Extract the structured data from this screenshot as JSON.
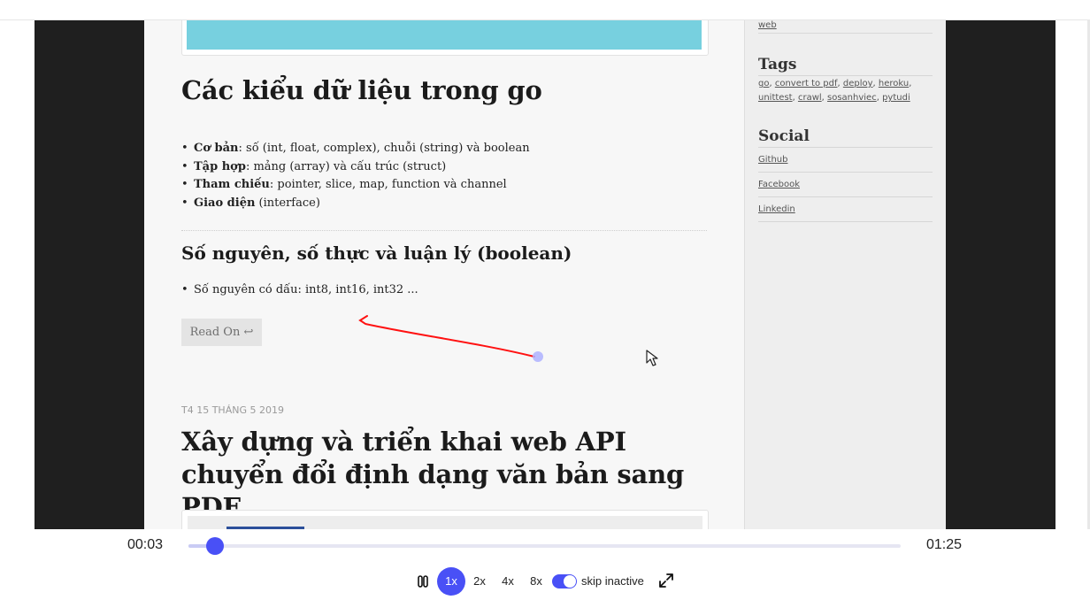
{
  "article": {
    "title": "Các kiểu dữ liệu trong go",
    "types": [
      {
        "term": "Cơ bản",
        "desc": ": số (int, float, complex), chuỗi (string) và boolean"
      },
      {
        "term": "Tập hợp",
        "desc": ": mảng (array) và cấu trúc (struct)"
      },
      {
        "term": "Tham chiếu",
        "desc": ": pointer, slice, map, function và channel"
      },
      {
        "term": "Giao diện",
        "desc": " (interface)"
      }
    ],
    "subtitle": "Số nguyên, số thực và luận lý (boolean)",
    "numbers": [
      "Số nguyên có dấu: int8, int16, int32 ..."
    ],
    "read_on": "Read On ↩"
  },
  "next_article": {
    "date": "T4 15 THÁNG 5 2019",
    "title": "Xây dựng và triển khai web API chuyển đổi định dạng văn bản sang PDF"
  },
  "sidebar": {
    "prev_link": "web",
    "tags_heading": "Tags",
    "tags": [
      "go",
      "convert to pdf",
      "deploy",
      "heroku",
      "unittest",
      "crawl",
      "sosanhviec",
      "pytudi"
    ],
    "social_heading": "Social",
    "social": [
      "Github",
      "Facebook",
      "Linkedin"
    ]
  },
  "player": {
    "current_time": "00:03",
    "total_time": "01:25",
    "progress": 0.037,
    "speeds": [
      "1x",
      "2x",
      "4x",
      "8x"
    ],
    "active_speed": "1x",
    "skip_inactive": true,
    "skip_label": "skip inactive",
    "accent_color": "#4950f6"
  }
}
